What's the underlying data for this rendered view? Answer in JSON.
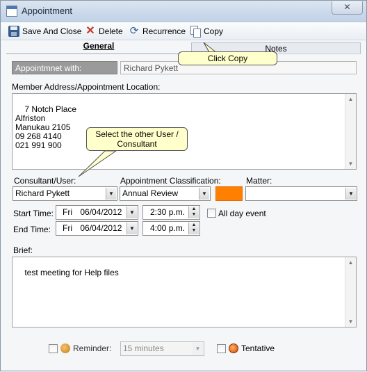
{
  "window": {
    "title": "Appointment",
    "close_glyph": "✕"
  },
  "toolbar": {
    "save_and_close": "Save And Close",
    "delete": "Delete",
    "recurrence": "Recurrence",
    "copy": "Copy"
  },
  "tabs": {
    "general": "General",
    "notes": "Notes"
  },
  "appointment_with": {
    "label": "Appointmnet with:",
    "value": "Richard Pykett"
  },
  "address": {
    "label": "Member Address/Appointment Location:",
    "value": "7 Notch Place\nAlfriston\nManukau 2105\n09 268 4140\n021 991 900"
  },
  "consultant": {
    "label": "Consultant/User:",
    "value": "Richard Pykett"
  },
  "classification": {
    "label": "Appointment Classification:",
    "value": "Annual Review",
    "color": "#ff8000"
  },
  "matter": {
    "label": "Matter:",
    "value": ""
  },
  "start": {
    "label": "Start Time:",
    "day": "Fri",
    "date": "06/04/2012",
    "time": "2:30 p.m."
  },
  "end": {
    "label": "End Time:",
    "day": "Fri",
    "date": "06/04/2012",
    "time": "4:00 p.m."
  },
  "all_day": {
    "label": "All day event",
    "checked": false
  },
  "brief": {
    "label": "Brief:",
    "value": "test meeting for Help files"
  },
  "reminder": {
    "label": "Reminder:",
    "value": "15 minutes",
    "checked": false
  },
  "tentative": {
    "label": "Tentative",
    "checked": false
  },
  "callouts": {
    "copy_tip": "Click Copy",
    "consultant_tip": "Select the other User / Consultant"
  }
}
